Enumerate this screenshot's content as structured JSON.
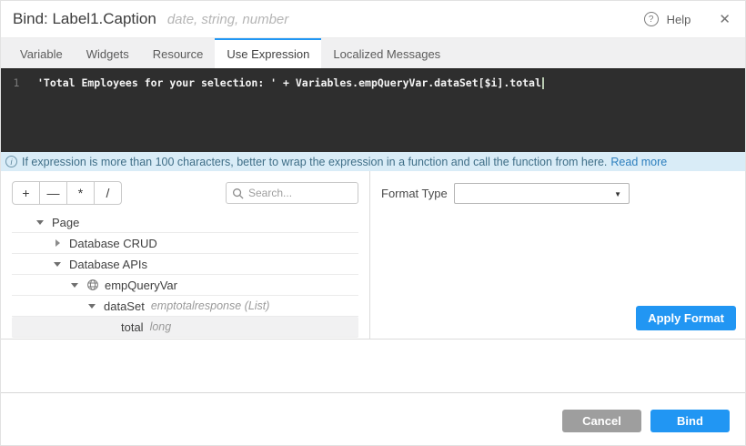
{
  "header": {
    "title": "Bind: Label1.Caption",
    "subtitle": "date, string, number",
    "help_label": "Help",
    "help_glyph": "?",
    "close_glyph": "✕"
  },
  "tabs": [
    {
      "label": "Variable",
      "active": false
    },
    {
      "label": "Widgets",
      "active": false
    },
    {
      "label": "Resource",
      "active": false
    },
    {
      "label": "Use Expression",
      "active": true
    },
    {
      "label": "Localized Messages",
      "active": false
    }
  ],
  "editor": {
    "line_number": "1",
    "code": "'Total Employees for your selection: ' + Variables.empQueryVar.dataSet[$i].total"
  },
  "info_bar": {
    "icon_glyph": "i",
    "text": "If expression is more than 100 characters, better to wrap the expression in a function and call the function from here.",
    "link_label": "Read more"
  },
  "toolbar": {
    "operators": [
      "+",
      "—",
      "*",
      "/"
    ],
    "search_placeholder": "Search..."
  },
  "tree": {
    "items": [
      {
        "label": "Page",
        "type": "",
        "level": 0,
        "state": "expanded",
        "icon": "",
        "selected": false
      },
      {
        "label": "Database CRUD",
        "type": "",
        "level": 1,
        "state": "collapsed",
        "icon": "",
        "selected": false
      },
      {
        "label": "Database APIs",
        "type": "",
        "level": 1,
        "state": "expanded",
        "icon": "",
        "selected": false
      },
      {
        "label": "empQueryVar",
        "type": "",
        "level": 2,
        "state": "expanded",
        "icon": "service-globe",
        "selected": false
      },
      {
        "label": "dataSet",
        "type": "emptotalresponse (List)",
        "level": 3,
        "state": "expanded",
        "icon": "",
        "selected": false
      },
      {
        "label": "total",
        "type": "long",
        "level": 4,
        "state": "leaf",
        "icon": "",
        "selected": true
      }
    ]
  },
  "format_panel": {
    "label": "Format Type",
    "selected_value": "",
    "apply_label": "Apply Format"
  },
  "footer": {
    "cancel_label": "Cancel",
    "bind_label": "Bind"
  },
  "colors": {
    "accent_blue": "#2196f3",
    "editor_bg": "#2e2e2e",
    "info_bg": "#d9ecf7",
    "info_text": "#3f6e87",
    "cancel_gray": "#9e9e9e",
    "selected_row_bg": "#f1f1f2"
  }
}
